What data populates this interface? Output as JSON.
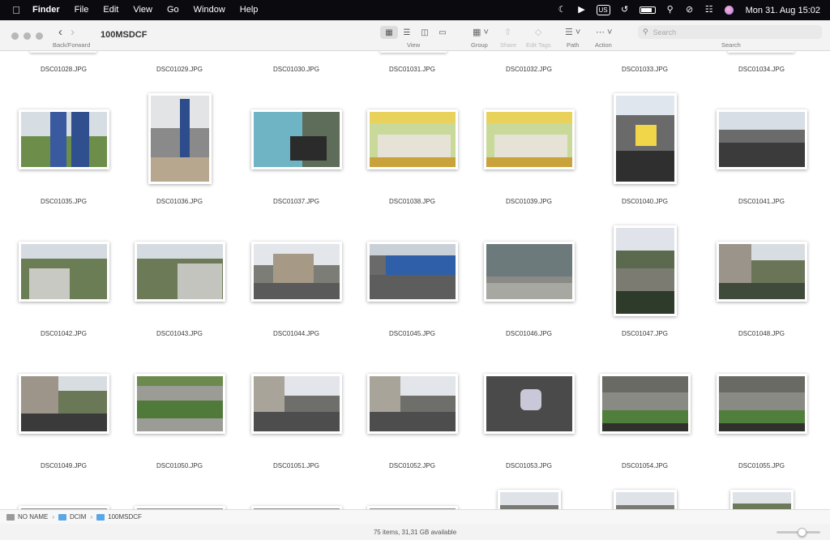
{
  "menubar": {
    "apple_icon": "apple-icon",
    "app_name": "Finder",
    "menus": [
      "File",
      "Edit",
      "View",
      "Go",
      "Window",
      "Help"
    ],
    "keyboard_layout": "US",
    "clock": "Mon 31. Aug  15:02"
  },
  "toolbar": {
    "back_forward_label": "Back/Forward",
    "title": "100MSDCF",
    "view_label": "View",
    "group_label": "Group",
    "share_label": "Share",
    "edit_tags_label": "Edit Tags",
    "path_label": "Path",
    "action_label": "Action",
    "search_label": "Search",
    "search_placeholder": "Search"
  },
  "files": {
    "row0": [
      "DSC01028.JPG",
      "DSC01029.JPG",
      "DSC01030.JPG",
      "DSC01031.JPG",
      "DSC01032.JPG",
      "DSC01033.JPG",
      "DSC01034.JPG"
    ],
    "row1": [
      "DSC01035.JPG",
      "DSC01036.JPG",
      "DSC01037.JPG",
      "DSC01038.JPG",
      "DSC01039.JPG",
      "DSC01040.JPG",
      "DSC01041.JPG"
    ],
    "row2": [
      "DSC01042.JPG",
      "DSC01043.JPG",
      "DSC01044.JPG",
      "DSC01045.JPG",
      "DSC01046.JPG",
      "DSC01047.JPG",
      "DSC01048.JPG"
    ],
    "row3": [
      "DSC01049.JPG",
      "DSC01050.JPG",
      "DSC01051.JPG",
      "DSC01052.JPG",
      "DSC01053.JPG",
      "DSC01054.JPG",
      "DSC01055.JPG"
    ]
  },
  "pathbar": {
    "crumbs": [
      "NO NAME",
      "DCIM",
      "100MSDCF"
    ]
  },
  "statusbar": {
    "text": "75 items, 31,31 GB available"
  },
  "colors": {
    "menubar_bg": "#0b0b0f",
    "toolbar_bg": "#f3f3f3",
    "folder_blue": "#5aa7e6"
  }
}
